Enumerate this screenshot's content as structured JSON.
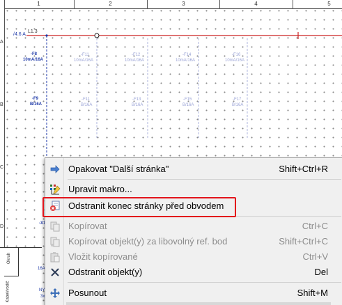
{
  "ruler": {
    "columns": [
      "1",
      "2",
      "3",
      "4",
      "5"
    ]
  },
  "left_ruler": {
    "marks": [
      "A",
      "B",
      "C",
      "D"
    ]
  },
  "schematic": {
    "line_label": "L1.3",
    "line_left_label": "/4.6 A",
    "breaker_row1": [
      {
        "name": "-F8",
        "rating": "10mA/16A",
        "style": "dark"
      },
      {
        "name": "-F11",
        "rating": "10mA/16A",
        "style": "faint"
      },
      {
        "name": "-F12",
        "rating": "10mA/16A",
        "style": "faint"
      },
      {
        "name": "-F14",
        "rating": "10mA/16A",
        "style": "faint"
      },
      {
        "name": "-F16",
        "rating": "10mA/16A",
        "style": "faint"
      }
    ],
    "breaker_row2": [
      {
        "name": "-F9",
        "rating": "B/16A",
        "style": "dark"
      },
      {
        "name": "-F11",
        "rating": "B/16A",
        "style": "faint"
      },
      {
        "name": "-F13",
        "rating": "B/16A",
        "style": "faint"
      },
      {
        "name": "-F15",
        "rating": "B/16A",
        "style": "faint"
      },
      {
        "name": "-F17",
        "rating": "B/16A",
        "style": "faint"
      }
    ],
    "lower_label": "-X1",
    "title_block": {
      "row1": "Okruh",
      "val1": "16A",
      "row2": "Kabel/vodič",
      "val2": "NY",
      "val3": "3x"
    }
  },
  "context_menu": {
    "items": [
      {
        "label": "Opakovat \"Další stránka\"",
        "shortcut": "Shift+Ctrl+R",
        "icon": "arrow-right-icon",
        "enabled": true
      },
      {
        "label": "Upravit makro...",
        "shortcut": "",
        "icon": "edit-macro-icon",
        "enabled": true
      },
      {
        "label": "Odstranit konec stránky před obvodem",
        "shortcut": "",
        "icon": "remove-page-break-icon",
        "enabled": true
      },
      {
        "label": "Kopírovat",
        "shortcut": "Ctrl+C",
        "icon": "copy-icon",
        "enabled": false
      },
      {
        "label": "Kopírovat objekt(y) za libovolný ref. bod",
        "shortcut": "Shift+Ctrl+C",
        "icon": "copy-ref-icon",
        "enabled": false
      },
      {
        "label": "Vložit kopírované",
        "shortcut": "Ctrl+V",
        "icon": "paste-icon",
        "enabled": false
      },
      {
        "label": "Odstranit objekt(y)",
        "shortcut": "Del",
        "icon": "delete-x-icon",
        "enabled": true
      },
      {
        "label": "Posunout",
        "shortcut": "Shift+M",
        "icon": "move-icon",
        "enabled": true
      }
    ]
  },
  "colors": {
    "line_red": "#cc2222",
    "highlight_red": "#e3141b",
    "schematic_blue": "#1f3aa8"
  }
}
